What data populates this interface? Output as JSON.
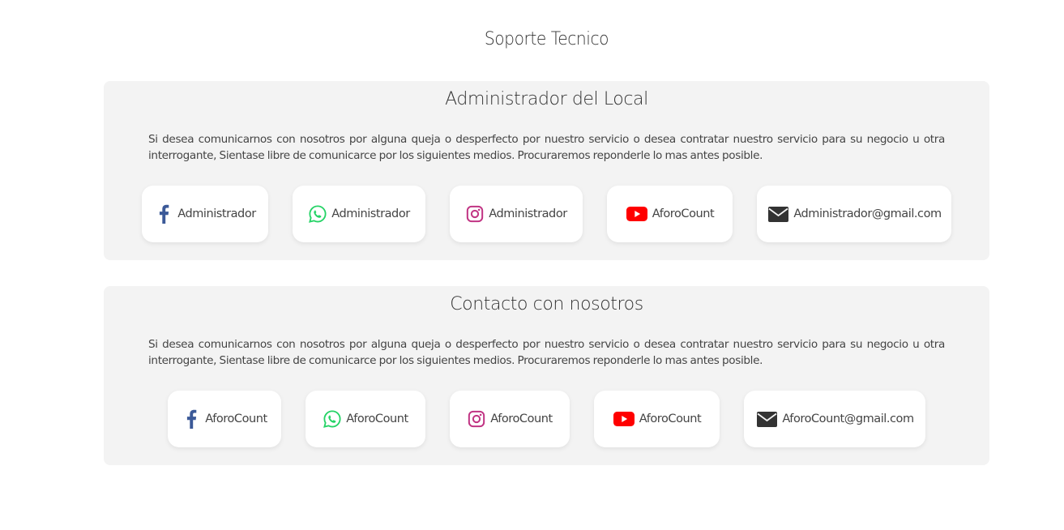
{
  "page": {
    "title": "Soporte Tecnico"
  },
  "colors": {
    "card_bg": "#f3f3f3",
    "facebook": "#3b5998",
    "whatsapp": "#25d366",
    "instagram": "#c13584",
    "youtube": "#ff0000",
    "mail": "#333333"
  },
  "sections": [
    {
      "title": "Administrador del Local",
      "description": "Si desea comunicarnos con nosotros por alguna queja o desperfecto por nuestro servicio o desea contratar nuestro servicio para su negocio u otra interrogante, Sientase libre de comunicarce por los siguientes medios. Procuraremos reponderle lo mas antes posible.",
      "contacts": [
        {
          "icon": "facebook-icon",
          "label": "Administrador"
        },
        {
          "icon": "whatsapp-icon",
          "label": "Administrador"
        },
        {
          "icon": "instagram-icon",
          "label": "Administrador"
        },
        {
          "icon": "youtube-icon",
          "label": "AforoCount"
        },
        {
          "icon": "mail-icon",
          "label": "Administrador@gmail.com"
        }
      ]
    },
    {
      "title": "Contacto con nosotros",
      "description": "Si desea comunicarnos con nosotros por alguna queja o desperfecto por nuestro servicio o desea contratar nuestro servicio para su negocio u otra interrogante, Sientase libre de comunicarce por los siguientes medios. Procuraremos reponderle lo mas antes posible.",
      "contacts": [
        {
          "icon": "facebook-icon",
          "label": "AforoCount"
        },
        {
          "icon": "whatsapp-icon",
          "label": "AforoCount"
        },
        {
          "icon": "instagram-icon",
          "label": "AforoCount"
        },
        {
          "icon": "youtube-icon",
          "label": "AforoCount"
        },
        {
          "icon": "mail-icon",
          "label": "AforoCount@gmail.com"
        }
      ]
    }
  ]
}
